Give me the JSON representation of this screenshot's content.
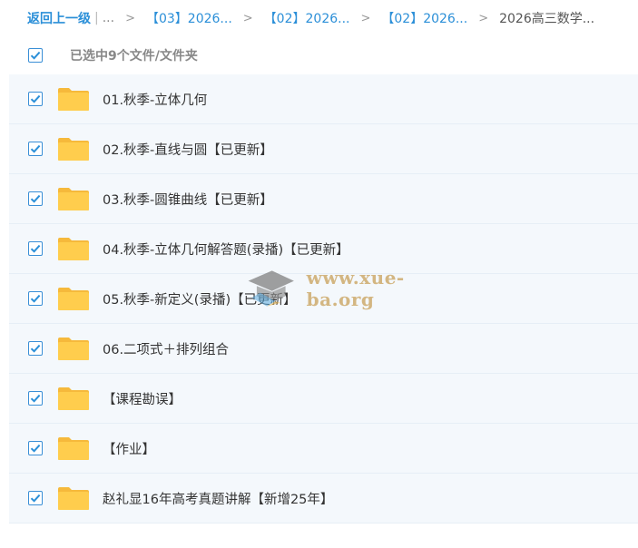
{
  "breadcrumb": {
    "back": "返回上一级",
    "sep": "|",
    "ellipsis": "...",
    "items": [
      "【03】2026...",
      "【02】2026...",
      "【02】2026..."
    ],
    "current": "2026高三数学...",
    "arrow": ">"
  },
  "header": {
    "label": "已选中9个文件/文件夹",
    "checked": true
  },
  "items": [
    {
      "name": "01.秋季-立体几何"
    },
    {
      "name": "02.秋季-直线与圆【已更新】"
    },
    {
      "name": "03.秋季-圆锥曲线【已更新】"
    },
    {
      "name": "04.秋季-立体几何解答题(录播)【已更新】"
    },
    {
      "name": "05.秋季-新定义(录播)【已更新】"
    },
    {
      "name": "06.二项式＋排列组合"
    },
    {
      "name": "【课程勘误】"
    },
    {
      "name": "【作业】"
    },
    {
      "name": "赵礼显16年高考真题讲解【新增25年】"
    }
  ],
  "watermark": {
    "text": "www.xue-ba.org"
  },
  "colors": {
    "accent": "#2b8fd8",
    "folder": "#ffcd4d",
    "row_bg": "#f4f8fc"
  }
}
